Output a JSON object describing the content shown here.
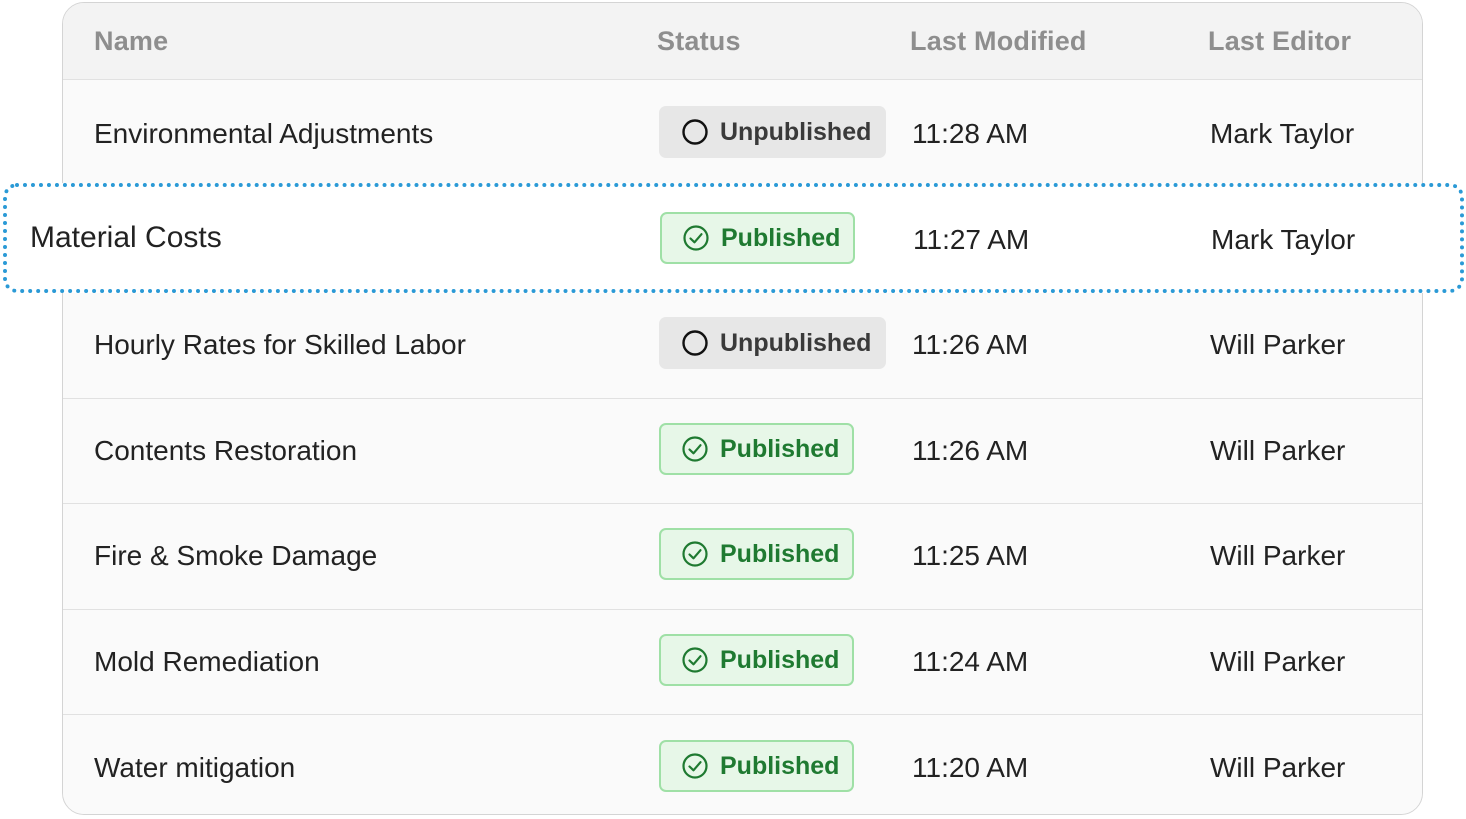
{
  "table": {
    "columns": {
      "name": "Name",
      "status": "Status",
      "last_modified": "Last Modified",
      "last_editor": "Last Editor"
    },
    "rows": [
      {
        "name": "Environmental Adjustments",
        "status": "Unpublished",
        "status_icon": "circle-icon",
        "modified": "11:28 AM",
        "editor": "Mark Taylor"
      },
      {
        "name": "Material Costs",
        "status": "Published",
        "status_icon": "check-circle-icon",
        "modified": "11:27 AM",
        "editor": "Mark Taylor",
        "highlighted": true
      },
      {
        "name": "Hourly Rates for Skilled Labor",
        "status": "Unpublished",
        "status_icon": "circle-icon",
        "modified": "11:26 AM",
        "editor": "Will Parker"
      },
      {
        "name": "Contents Restoration",
        "status": "Published",
        "status_icon": "check-circle-icon",
        "modified": "11:26 AM",
        "editor": "Will Parker"
      },
      {
        "name": "Fire & Smoke Damage",
        "status": "Published",
        "status_icon": "check-circle-icon",
        "modified": "11:25 AM",
        "editor": "Will Parker"
      },
      {
        "name": "Mold Remediation",
        "status": "Published",
        "status_icon": "check-circle-icon",
        "modified": "11:24 AM",
        "editor": "Will Parker"
      },
      {
        "name": "Water mitigation",
        "status": "Published",
        "status_icon": "check-circle-icon",
        "modified": "11:20 AM",
        "editor": "Will Parker"
      }
    ]
  },
  "colors": {
    "published_bg": "#e7f7e8",
    "published_border": "#9fe0a6",
    "published_text": "#1f7a31",
    "unpublished_bg": "#e7e7e7",
    "highlight_border": "#2b9ad6"
  }
}
